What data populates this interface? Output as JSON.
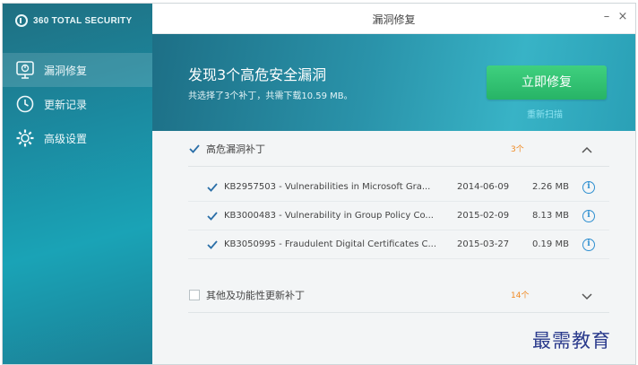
{
  "brand": {
    "name": "360 TOTAL SECURITY"
  },
  "window": {
    "title": "漏洞修复",
    "minimize": "–",
    "close": "×"
  },
  "sidebar": {
    "items": [
      {
        "label": "漏洞修复",
        "icon": "vulnerability-monitor-icon",
        "active": true
      },
      {
        "label": "更新记录",
        "icon": "clock-icon",
        "active": false
      },
      {
        "label": "高级设置",
        "icon": "gear-icon",
        "active": false
      }
    ]
  },
  "banner": {
    "title": "发现3个高危安全漏洞",
    "subtitle": "共选择了3个补丁，共需下载10.59 MB。",
    "fix_button": "立即修复",
    "rescan": "重新扫描"
  },
  "sections": {
    "critical": {
      "label": "高危漏洞补丁",
      "count": "3个",
      "checked": true,
      "expanded": true
    },
    "other": {
      "label": "其他及功能性更新补丁",
      "count": "14个",
      "checked": false,
      "expanded": false
    }
  },
  "patches": [
    {
      "name": "KB2957503 - Vulnerabilities in Microsoft Gra...",
      "date": "2014-06-09",
      "size": "2.26 MB",
      "checked": true
    },
    {
      "name": "KB3000483 - Vulnerability in Group Policy Co...",
      "date": "2015-02-09",
      "size": "8.13 MB",
      "checked": true
    },
    {
      "name": "KB3050995 - Fraudulent Digital Certificates C...",
      "date": "2015-03-27",
      "size": "0.19 MB",
      "checked": true
    }
  ],
  "watermark": "最需教育",
  "colors": {
    "accent_green": "#2fbf6f",
    "sidebar_teal": "#1b8aa0",
    "count_orange": "#f08a23",
    "info_blue": "#2e8fd0"
  }
}
